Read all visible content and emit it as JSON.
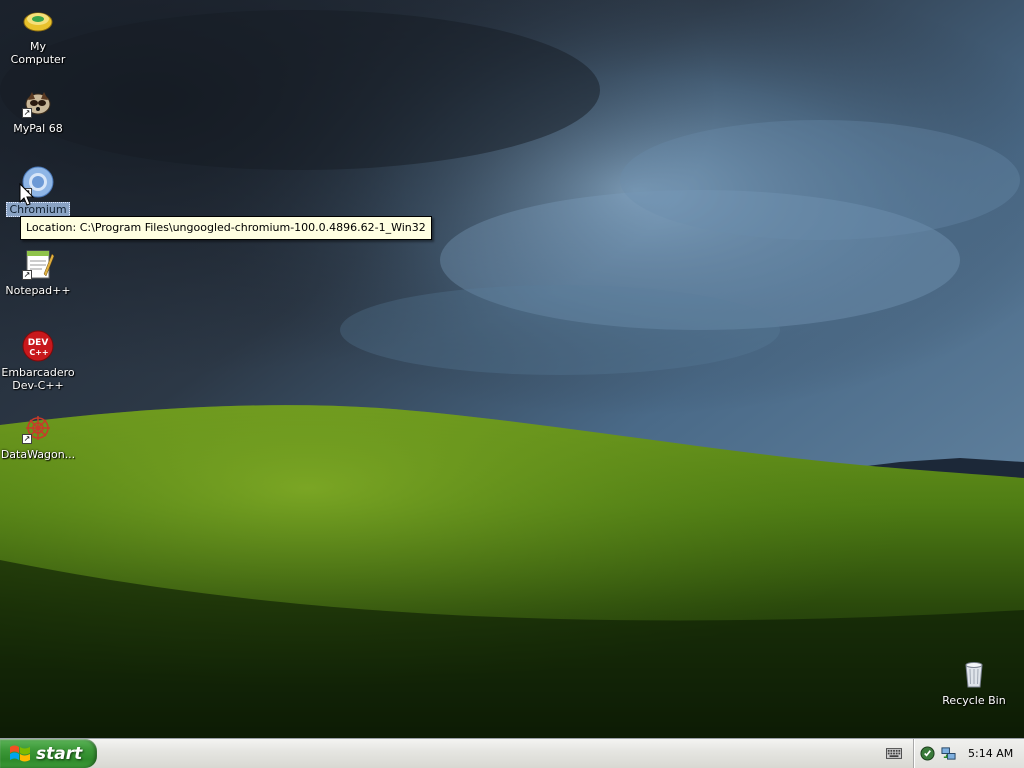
{
  "desktop": {
    "icons": [
      {
        "label": "My Computer",
        "icon": "my-computer-icon"
      },
      {
        "label": "MyPal 68",
        "icon": "mypal-icon"
      },
      {
        "label": "Chromium",
        "icon": "chromium-icon"
      },
      {
        "label": "Notepad++",
        "icon": "notepad-plus-plus-icon"
      },
      {
        "label": "Embarcadero Dev-C++",
        "icon": "dev-cpp-icon",
        "badge": "DEV C++"
      },
      {
        "label": "DataWagon...",
        "icon": "datawagon-icon"
      },
      {
        "label": "Recycle Bin",
        "icon": "recycle-bin-icon"
      }
    ],
    "tooltip": "Location: C:\\Program Files\\ungoogled-chromium-100.0.4896.62-1_Win32"
  },
  "taskbar": {
    "start_label": "start",
    "clock": "5:14 AM",
    "tray_icons": [
      "shield-icon",
      "network-icon"
    ],
    "keyboard_icon": "keyboard-icon"
  },
  "colors": {
    "start_green": "#3e9a3a",
    "taskbar_bg": "#e6e6e2",
    "tooltip_bg": "#ffffe1"
  }
}
